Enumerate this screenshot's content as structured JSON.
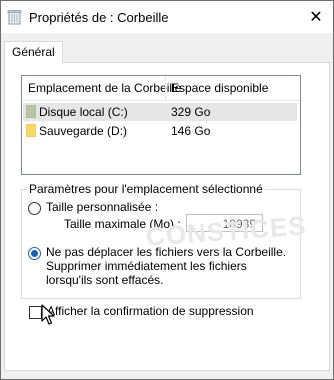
{
  "window": {
    "title": "Propriétés de : Corbeille",
    "close_glyph": "✕"
  },
  "tabs": [
    {
      "label": "Général"
    }
  ],
  "listview": {
    "headers": [
      "Emplacement de la Corbeille",
      "Espace disponible"
    ],
    "rows": [
      {
        "name": "Disque local (C:)",
        "space": "329 Go",
        "icon": "drive-icon",
        "color": "#b7c4a5"
      },
      {
        "name": "Sauvegarde (D:)",
        "space": "146 Go",
        "icon": "folder-icon",
        "color": "#f5d96b"
      }
    ]
  },
  "settings": {
    "legend": "Paramètres pour l'emplacement sélectionné",
    "custom_size_label": "Taille personnalisée :",
    "max_size_label": "Taille maximale (Mo) :",
    "max_size_value": "18939",
    "no_move_label": "Ne pas déplacer les fichiers vers la Corbeille. Supprimer immédiatement les fichiers lorsqu'ils sont effacés.",
    "selected_option": "no_move"
  },
  "confirm_label": "Afficher la confirmation de suppression",
  "confirm_checked": false,
  "watermark": "CONSTICES"
}
